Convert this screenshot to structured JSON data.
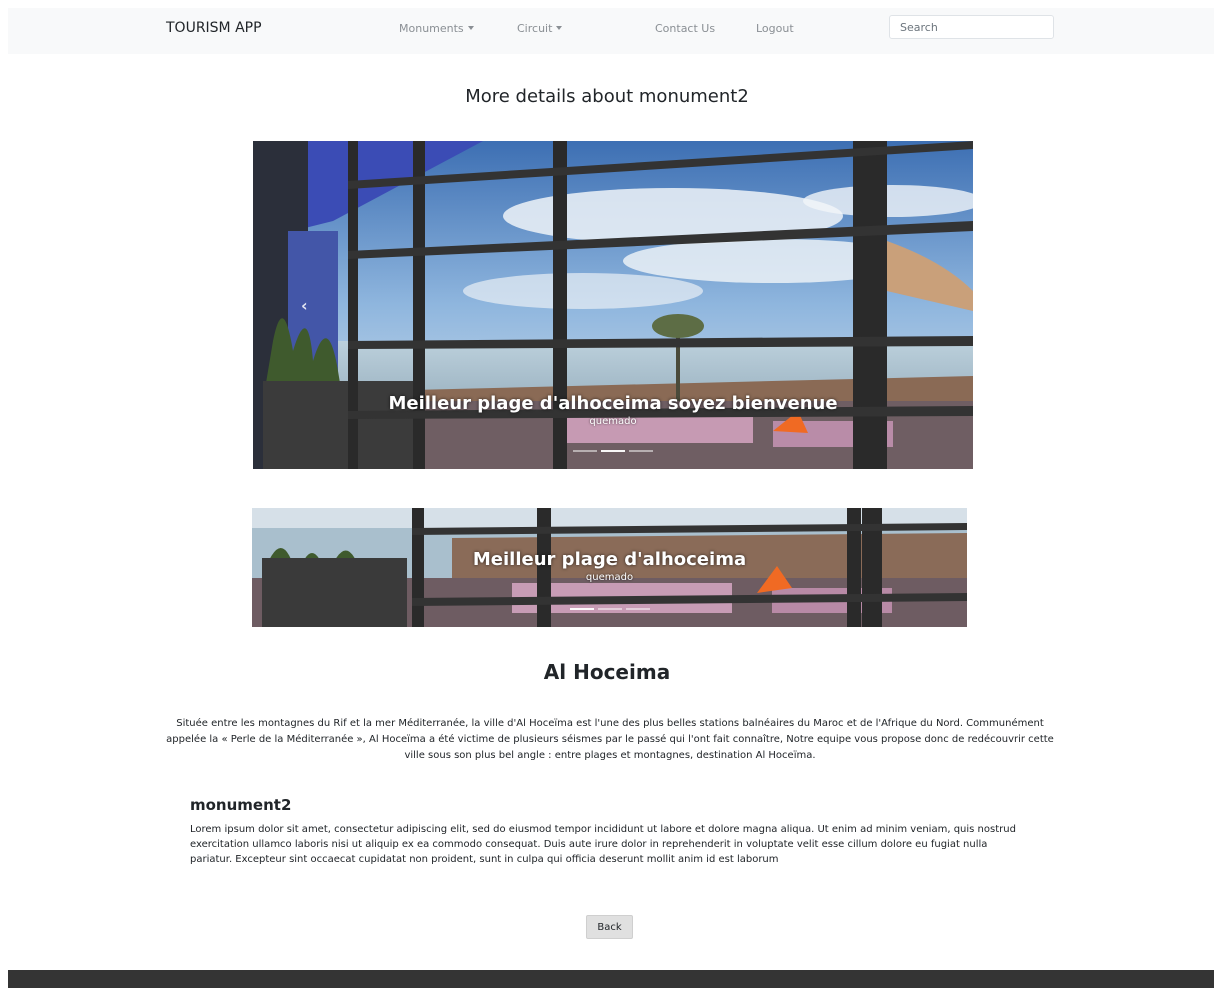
{
  "navbar": {
    "brand": "TOURISM APP",
    "monuments": "Monuments",
    "circuit": "Circuit",
    "contact": "Contact Us",
    "logout": "Logout",
    "search_placeholder": "Search"
  },
  "page": {
    "title": "More details about monument2"
  },
  "carousel_main": {
    "caption_title": "Meilleur plage d'alhoceima soyez bienvenue",
    "caption_sub": "quemado",
    "slides": 3,
    "active_slide": 2
  },
  "carousel_secondary": {
    "caption_title": "Meilleur plage d'alhoceima",
    "caption_sub": "quemado",
    "slides": 3,
    "active_slide": 1
  },
  "city": {
    "name": "Al Hoceima",
    "description": "Située entre les montagnes du Rif et la mer Méditerranée, la ville d'Al Hoceïma est l'une des plus belles stations balnéaires du Maroc et de l'Afrique du Nord. Communément appelée la « Perle de la Méditerranée », Al Hoceïma a été victime de plusieurs séismes par le passé qui l'ont fait connaître, Notre equipe vous propose donc de redécouvrir cette ville sous son plus bel angle : entre plages et montagnes, destination Al Hoceïma."
  },
  "monument": {
    "name": "monument2",
    "description": "Lorem ipsum dolor sit amet, consectetur adipiscing elit, sed do eiusmod tempor incididunt ut labore et dolore magna aliqua. Ut enim ad minim veniam, quis nostrud exercitation ullamco laboris nisi ut aliquip ex ea commodo consequat. Duis aute irure dolor in reprehenderit in voluptate velit esse cillum dolore eu fugiat nulla pariatur. Excepteur sint occaecat cupidatat non proident, sunt in culpa qui officia deserunt mollit anim id est laborum"
  },
  "actions": {
    "back_label": "Back"
  },
  "colors": {
    "navbar_bg": "#f8f9fa",
    "footer_bg": "#343434",
    "nav_link": "#8a8f94"
  }
}
